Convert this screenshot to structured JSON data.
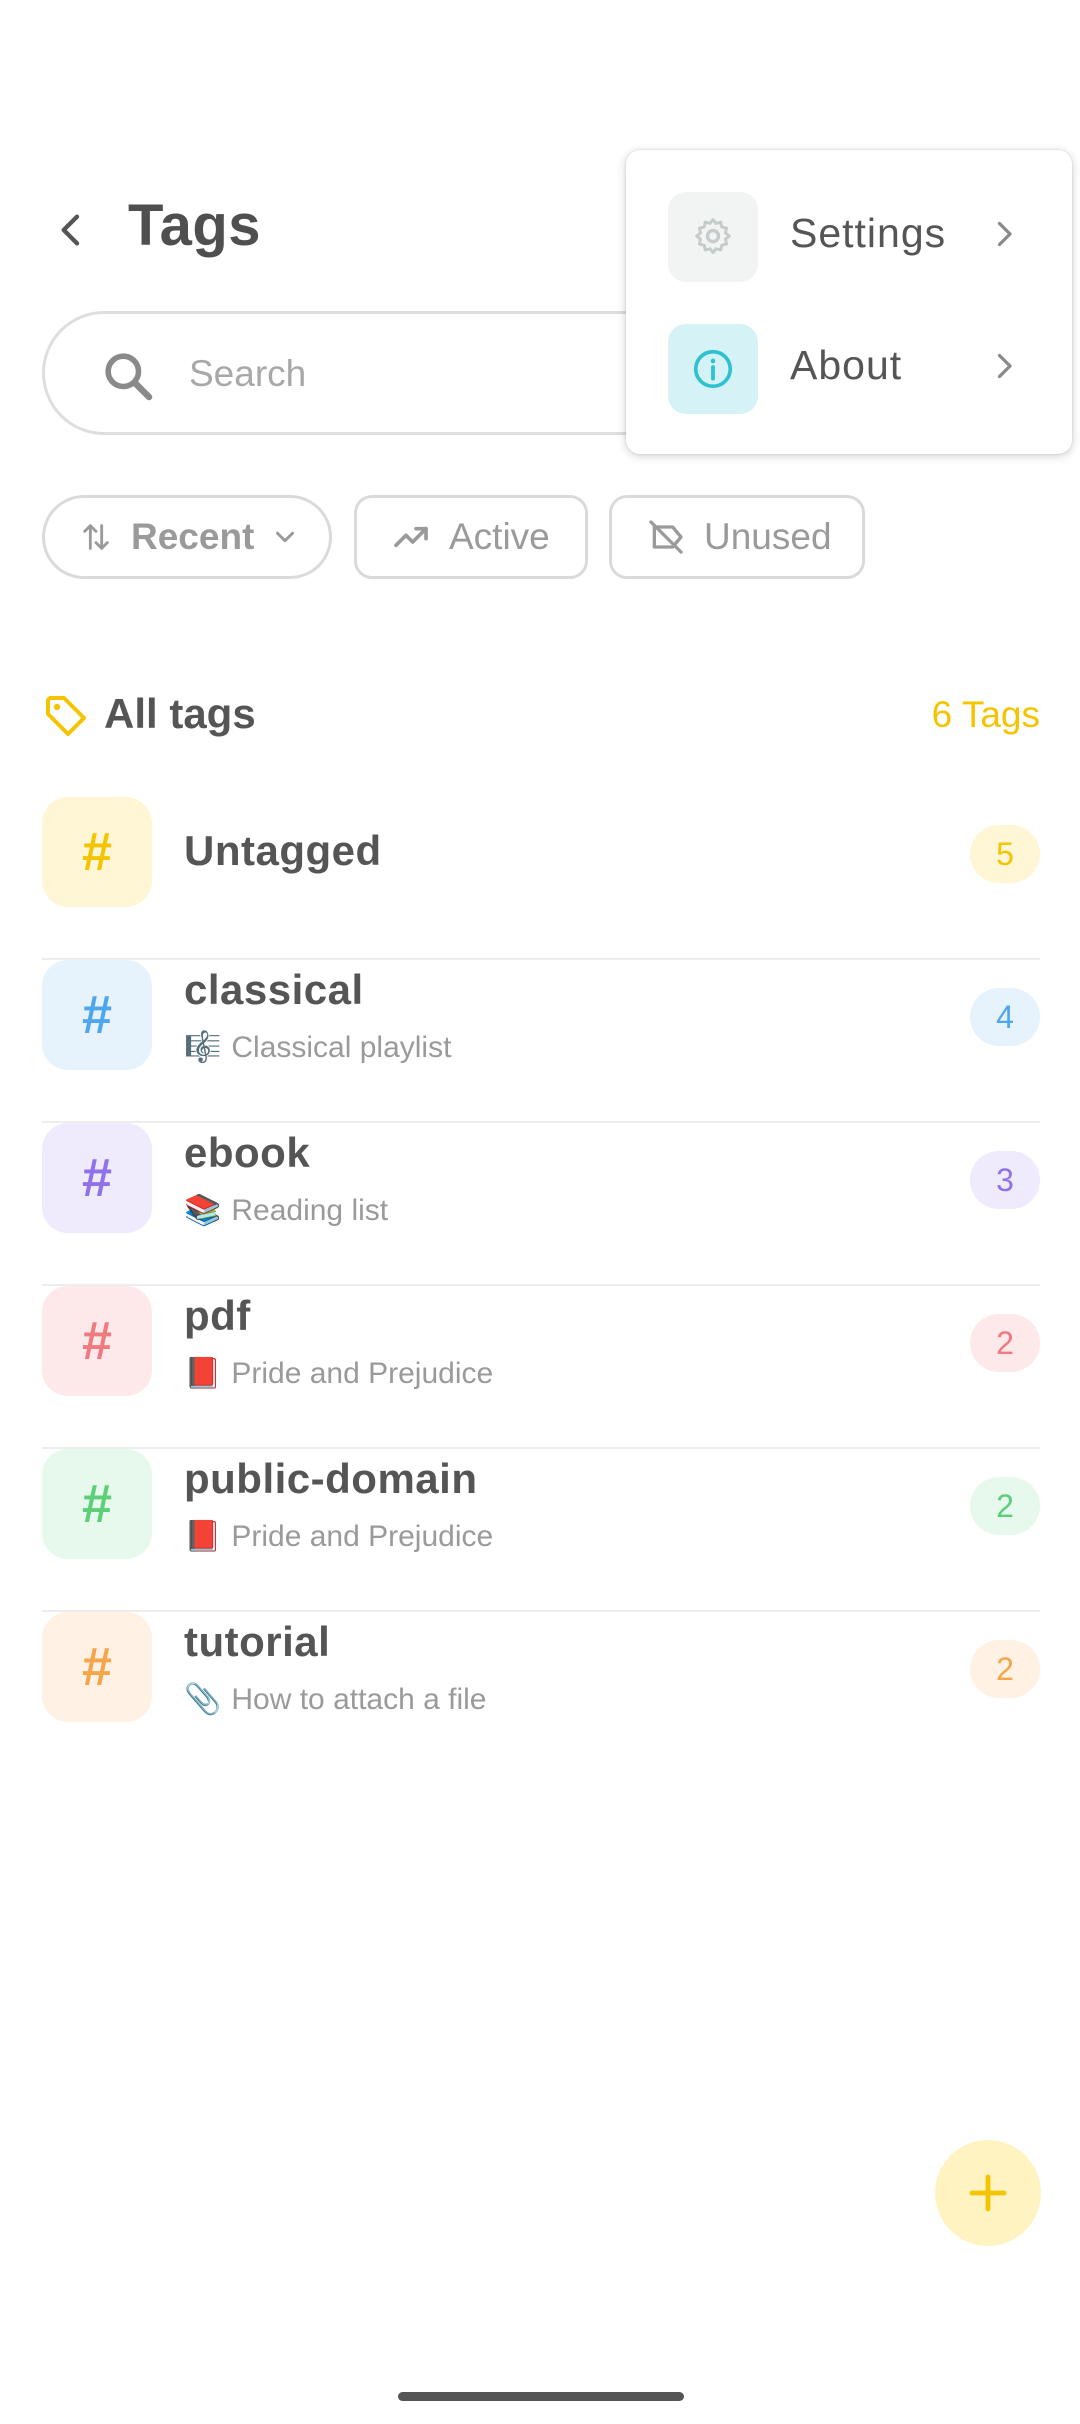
{
  "header": {
    "title": "Tags",
    "back_icon": "arrow-back-icon"
  },
  "search": {
    "placeholder": "Search",
    "value": ""
  },
  "filters": [
    {
      "label": "Recent",
      "icon": "sort-arrows-icon",
      "selected": true,
      "has_dropdown": true
    },
    {
      "label": "Active",
      "icon": "trending-up-icon",
      "selected": false
    },
    {
      "label": "Unused",
      "icon": "label-off-icon",
      "selected": false
    }
  ],
  "section": {
    "title": "All tags",
    "count_label": "6 Tags",
    "icon": "tag-icon"
  },
  "tags": [
    {
      "name": "Untagged",
      "subtitle": "",
      "emoji": "",
      "count": "5",
      "color": "#f5c400",
      "bg": "#fff6d6"
    },
    {
      "name": "classical",
      "subtitle": "Classical playlist",
      "emoji": "🎼",
      "count": "4",
      "color": "#4ea6ef",
      "bg": "#e6f3fd"
    },
    {
      "name": "ebook",
      "subtitle": "Reading list",
      "emoji": "📚",
      "count": "3",
      "color": "#8f72ea",
      "bg": "#efeafc"
    },
    {
      "name": "pdf",
      "subtitle": "Pride and Prejudice",
      "emoji": "📕",
      "count": "2",
      "color": "#f07a80",
      "bg": "#fde9ea"
    },
    {
      "name": "public-domain",
      "subtitle": "Pride and Prejudice",
      "emoji": "📕",
      "count": "2",
      "color": "#5ccf78",
      "bg": "#e7f8ec"
    },
    {
      "name": "tutorial",
      "subtitle": "How to attach a file",
      "emoji": "📎",
      "count": "2",
      "color": "#f7a54a",
      "bg": "#fff1e3"
    }
  ],
  "menu": {
    "items": [
      {
        "label": "Settings",
        "icon": "gear-icon",
        "icon_bg": "#f2f3f3",
        "icon_color": "#c5cacb"
      },
      {
        "label": "About",
        "icon": "info-icon",
        "icon_bg": "#d5f3f6",
        "icon_color": "#2ec1d0"
      }
    ]
  },
  "fab": {
    "icon": "plus-icon",
    "color": "#f5c400",
    "bg": "#fff3c2"
  }
}
